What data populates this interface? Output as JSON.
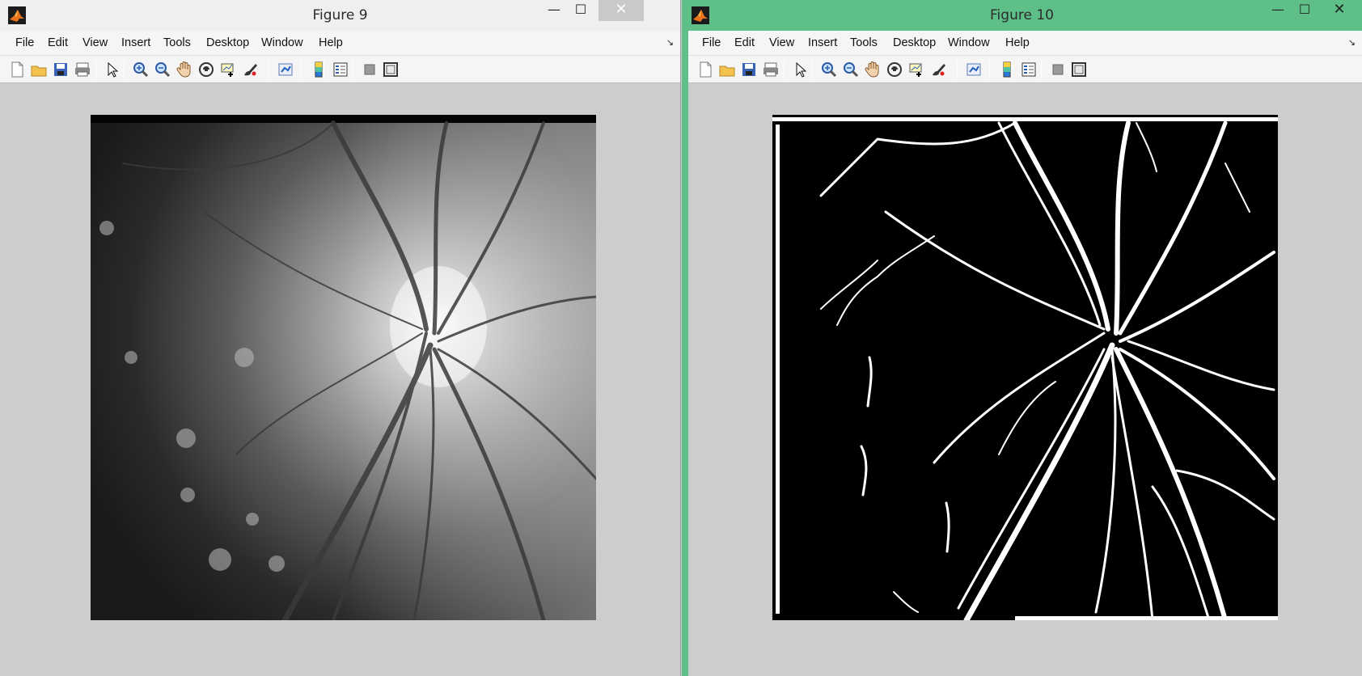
{
  "windows": [
    {
      "title": "Figure 9",
      "menu": [
        "File",
        "Edit",
        "View",
        "Insert",
        "Tools",
        "Desktop",
        "Window",
        "Help"
      ],
      "image_kind": "grayscale fundus image",
      "icons": [
        "new-figure-icon",
        "open-file-icon",
        "save-icon",
        "print-icon",
        "edit-plot-arrow-icon",
        "zoom-in-icon",
        "zoom-out-icon",
        "pan-hand-icon",
        "rotate-3d-icon",
        "data-cursor-icon",
        "brush-icon",
        "link-plot-icon",
        "colorbar-icon",
        "legend-icon",
        "hide-plot-tools-icon",
        "show-plot-tools-icon"
      ]
    },
    {
      "title": "Figure 10",
      "menu": [
        "File",
        "Edit",
        "View",
        "Insert",
        "Tools",
        "Desktop",
        "Window",
        "Help"
      ],
      "image_kind": "binary vessel segmentation",
      "icons": [
        "new-figure-icon",
        "open-file-icon",
        "save-icon",
        "print-icon",
        "edit-plot-arrow-icon",
        "zoom-in-icon",
        "zoom-out-icon",
        "pan-hand-icon",
        "rotate-3d-icon",
        "data-cursor-icon",
        "brush-icon",
        "link-plot-icon",
        "colorbar-icon",
        "legend-icon",
        "hide-plot-tools-icon",
        "show-plot-tools-icon"
      ]
    }
  ],
  "controls": {
    "minimize": "—",
    "maximize": "☐",
    "close": "✕",
    "dock": "↘"
  },
  "colors": {
    "active_titlebar": "#5ec088",
    "inactive_titlebar": "#efefef",
    "figure_bg": "#cdcdcd"
  }
}
